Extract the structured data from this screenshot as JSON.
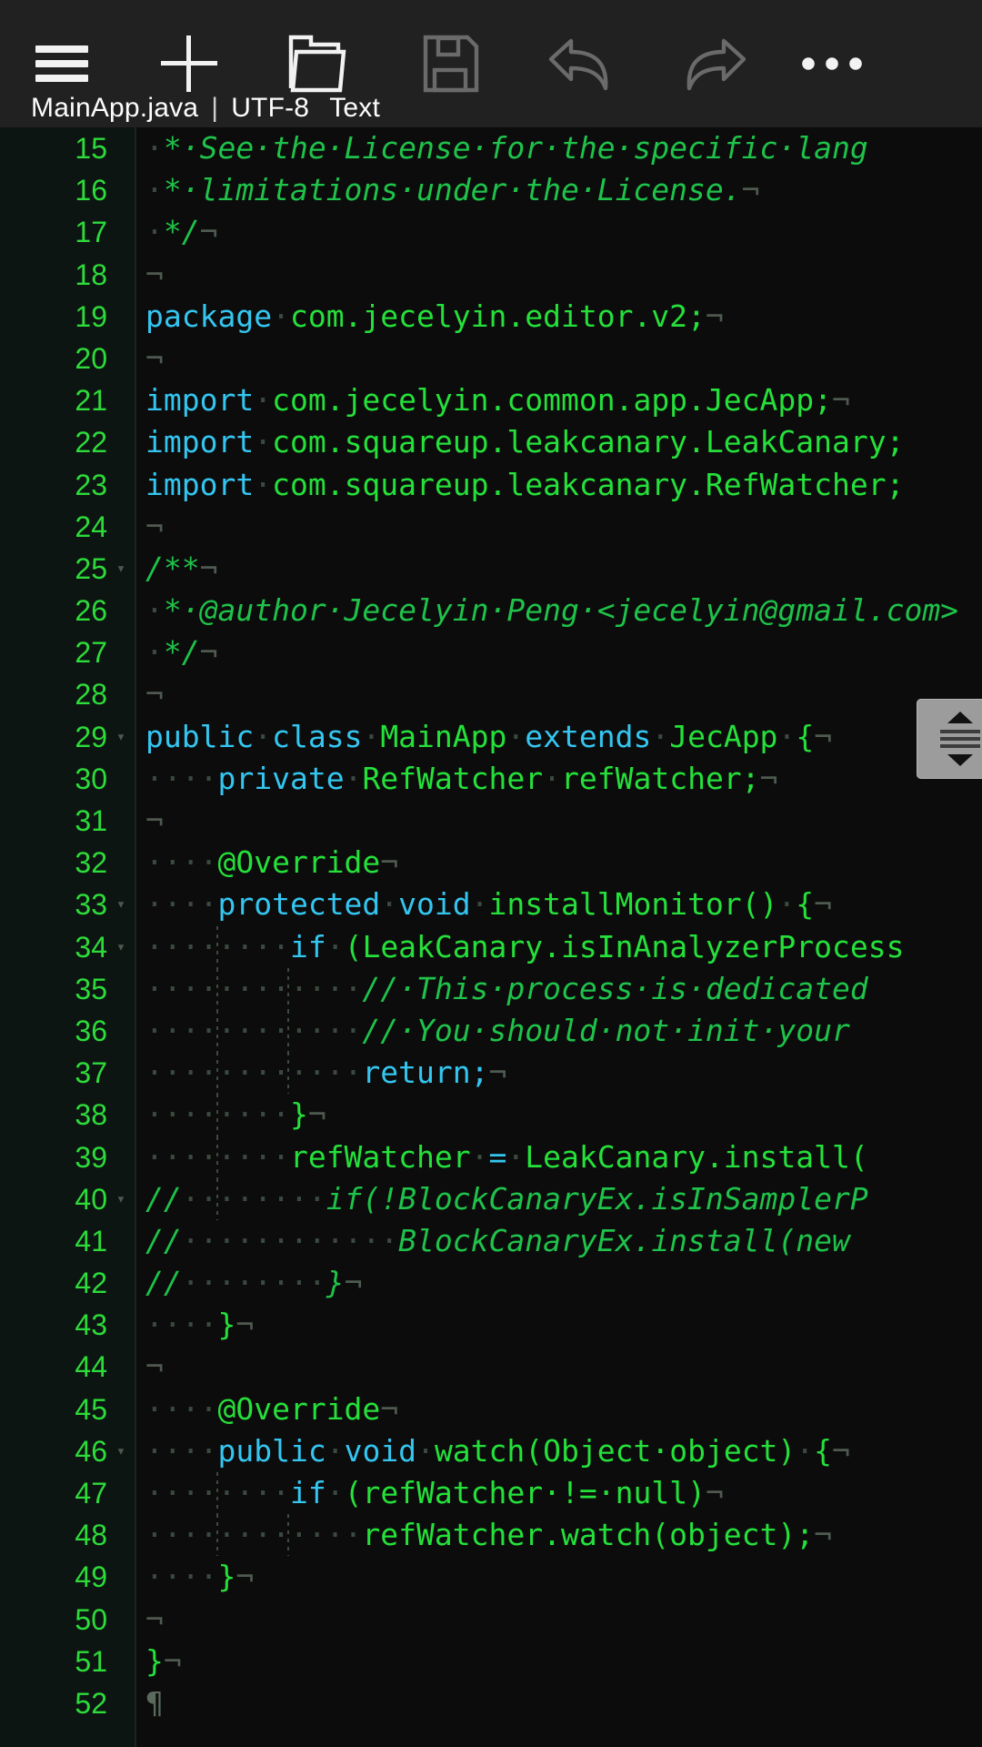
{
  "toolbar": {
    "menu_label": "Menu",
    "new_label": "New",
    "open_label": "Open",
    "save_label": "Save",
    "undo_label": "Undo",
    "redo_label": "Redo",
    "more_label": "More options"
  },
  "status": {
    "filename": "MainApp.java",
    "separator": "|",
    "encoding": "UTF-8",
    "filetype": "Text"
  },
  "scrollbar": {
    "up_label": "▲",
    "down_label": "▼"
  },
  "editor": {
    "first_line": 15,
    "last_line": 52,
    "colors": {
      "background": "#0c0c0c",
      "gutter": "#0d1512",
      "line_number": "#2ddb3a",
      "keyword": "#34c6f0",
      "identifier": "#25e03a",
      "comment": "#1fc24a",
      "whitespace_dot": "#3b4a3e",
      "eol_marker": "#4e5a50"
    },
    "lines": [
      {
        "n": "15",
        "fold": "",
        "html": "<span class='dot'>·</span><span class='cmt'>*·See·the·License·for·the·specific·lang</span>"
      },
      {
        "n": "16",
        "fold": "",
        "html": "<span class='dot'>·</span><span class='cmt'>*·limitations·under·the·License.</span><span class='eol'>¬</span>"
      },
      {
        "n": "17",
        "fold": "",
        "html": "<span class='dot'>·</span><span class='cmt'>*/</span><span class='eol'>¬</span>"
      },
      {
        "n": "18",
        "fold": "",
        "html": "<span class='eol'>¬</span>"
      },
      {
        "n": "19",
        "fold": "",
        "html": "<span class='kw'>package</span><span class='dot'>·</span><span class='id'>com.jecelyin.editor.v2;</span><span class='eol'>¬</span>"
      },
      {
        "n": "20",
        "fold": "",
        "html": "<span class='eol'>¬</span>"
      },
      {
        "n": "21",
        "fold": "",
        "html": "<span class='kw'>import</span><span class='dot'>·</span><span class='id'>com.jecelyin.common.app.JecApp;</span><span class='eol'>¬</span>"
      },
      {
        "n": "22",
        "fold": "",
        "html": "<span class='kw'>import</span><span class='dot'>·</span><span class='id'>com.squareup.leakcanary.LeakCanary;</span>"
      },
      {
        "n": "23",
        "fold": "",
        "html": "<span class='kw'>import</span><span class='dot'>·</span><span class='id'>com.squareup.leakcanary.RefWatcher;</span>"
      },
      {
        "n": "24",
        "fold": "",
        "html": "<span class='eol'>¬</span>"
      },
      {
        "n": "25",
        "fold": "▾",
        "html": "<span class='cmt'>/**</span><span class='eol'>¬</span>"
      },
      {
        "n": "26",
        "fold": "",
        "html": "<span class='dot'>·</span><span class='cmt'>*·@author·Jecelyin·Peng·&lt;jecelyin@gmail.com&gt;</span>"
      },
      {
        "n": "27",
        "fold": "",
        "html": "<span class='dot'>·</span><span class='cmt'>*/</span><span class='eol'>¬</span>"
      },
      {
        "n": "28",
        "fold": "",
        "html": "<span class='eol'>¬</span>"
      },
      {
        "n": "29",
        "fold": "▾",
        "html": "<span class='kw'>public</span><span class='dot'>·</span><span class='kw'>class</span><span class='dot'>·</span><span class='id'>MainApp</span><span class='dot'>·</span><span class='kw'>extends</span><span class='dot'>·</span><span class='id'>JecApp</span><span class='dot'>·</span><span class='id'>{</span><span class='eol'>¬</span>"
      },
      {
        "n": "30",
        "fold": "",
        "html": "<span class='dot'>····</span><span class='kw'>private</span><span class='dot'>·</span><span class='id'>RefWatcher</span><span class='dot'>·</span><span class='id'>refWatcher;</span><span class='eol'>¬</span>"
      },
      {
        "n": "31",
        "fold": "",
        "html": "<span class='eol'>¬</span>"
      },
      {
        "n": "32",
        "fold": "",
        "html": "<span class='dot'>····</span><span class='id'>@Override</span><span class='eol'>¬</span>"
      },
      {
        "n": "33",
        "fold": "▾",
        "html": "<span class='dot'>····</span><span class='kw'>protected</span><span class='dot'>·</span><span class='kw'>void</span><span class='dot'>·</span><span class='id'>installMonitor()</span><span class='dot'>·</span><span class='id'>{</span><span class='eol'>¬</span>"
      },
      {
        "n": "34",
        "fold": "▾",
        "html": "<span class='dot'>········</span><span class='kw'>if</span><span class='dot'>·</span><span class='id'>(LeakCanary.isInAnalyzerProcess</span>"
      },
      {
        "n": "35",
        "fold": "",
        "html": "<span class='dot'>············</span><span class='cmt'>//·This·process·is·dedicated</span>"
      },
      {
        "n": "36",
        "fold": "",
        "html": "<span class='dot'>············</span><span class='cmt'>//·You·should·not·init·your</span>"
      },
      {
        "n": "37",
        "fold": "",
        "html": "<span class='dot'>············</span><span class='kw'>return;</span><span class='eol'>¬</span>"
      },
      {
        "n": "38",
        "fold": "",
        "html": "<span class='dot'>········</span><span class='id'>}</span><span class='eol'>¬</span>"
      },
      {
        "n": "39",
        "fold": "",
        "html": "<span class='dot'>········</span><span class='id'>refWatcher</span><span class='dot'>·</span><span class='op'>=</span><span class='dot'>·</span><span class='id'>LeakCanary.install(</span>"
      },
      {
        "n": "40",
        "fold": "▾",
        "html": "<span class='cmt'>//</span><span class='dot'>········</span><span class='cmt'>if(!BlockCanaryEx.isInSamplerP</span>"
      },
      {
        "n": "41",
        "fold": "",
        "html": "<span class='cmt'>//</span><span class='dot'>············</span><span class='cmt'>BlockCanaryEx.install(new</span>"
      },
      {
        "n": "42",
        "fold": "",
        "html": "<span class='cmt'>//</span><span class='dot'>········</span><span class='cmt'>}</span><span class='eol'>¬</span>"
      },
      {
        "n": "43",
        "fold": "",
        "html": "<span class='dot'>····</span><span class='id'>}</span><span class='eol'>¬</span>"
      },
      {
        "n": "44",
        "fold": "",
        "html": "<span class='eol'>¬</span>"
      },
      {
        "n": "45",
        "fold": "",
        "html": "<span class='dot'>····</span><span class='id'>@Override</span><span class='eol'>¬</span>"
      },
      {
        "n": "46",
        "fold": "▾",
        "html": "<span class='dot'>····</span><span class='kw'>public</span><span class='dot'>·</span><span class='kw'>void</span><span class='dot'>·</span><span class='id'>watch(Object·object)</span><span class='dot'>·</span><span class='id'>{</span><span class='eol'>¬</span>"
      },
      {
        "n": "47",
        "fold": "",
        "html": "<span class='dot'>········</span><span class='kw'>if</span><span class='dot'>·</span><span class='id'>(refWatcher·!=·null)</span><span class='eol'>¬</span>"
      },
      {
        "n": "48",
        "fold": "",
        "html": "<span class='dot'>············</span><span class='id'>refWatcher.watch(object);</span><span class='eol'>¬</span>"
      },
      {
        "n": "49",
        "fold": "",
        "html": "<span class='dot'>····</span><span class='id'>}</span><span class='eol'>¬</span>"
      },
      {
        "n": "50",
        "fold": "",
        "html": "<span class='eol'>¬</span>"
      },
      {
        "n": "51",
        "fold": "",
        "html": "<span class='id'>}</span><span class='eol'>¬</span>"
      },
      {
        "n": "52",
        "fold": "",
        "html": "<span class='pil'>¶</span>"
      }
    ]
  }
}
